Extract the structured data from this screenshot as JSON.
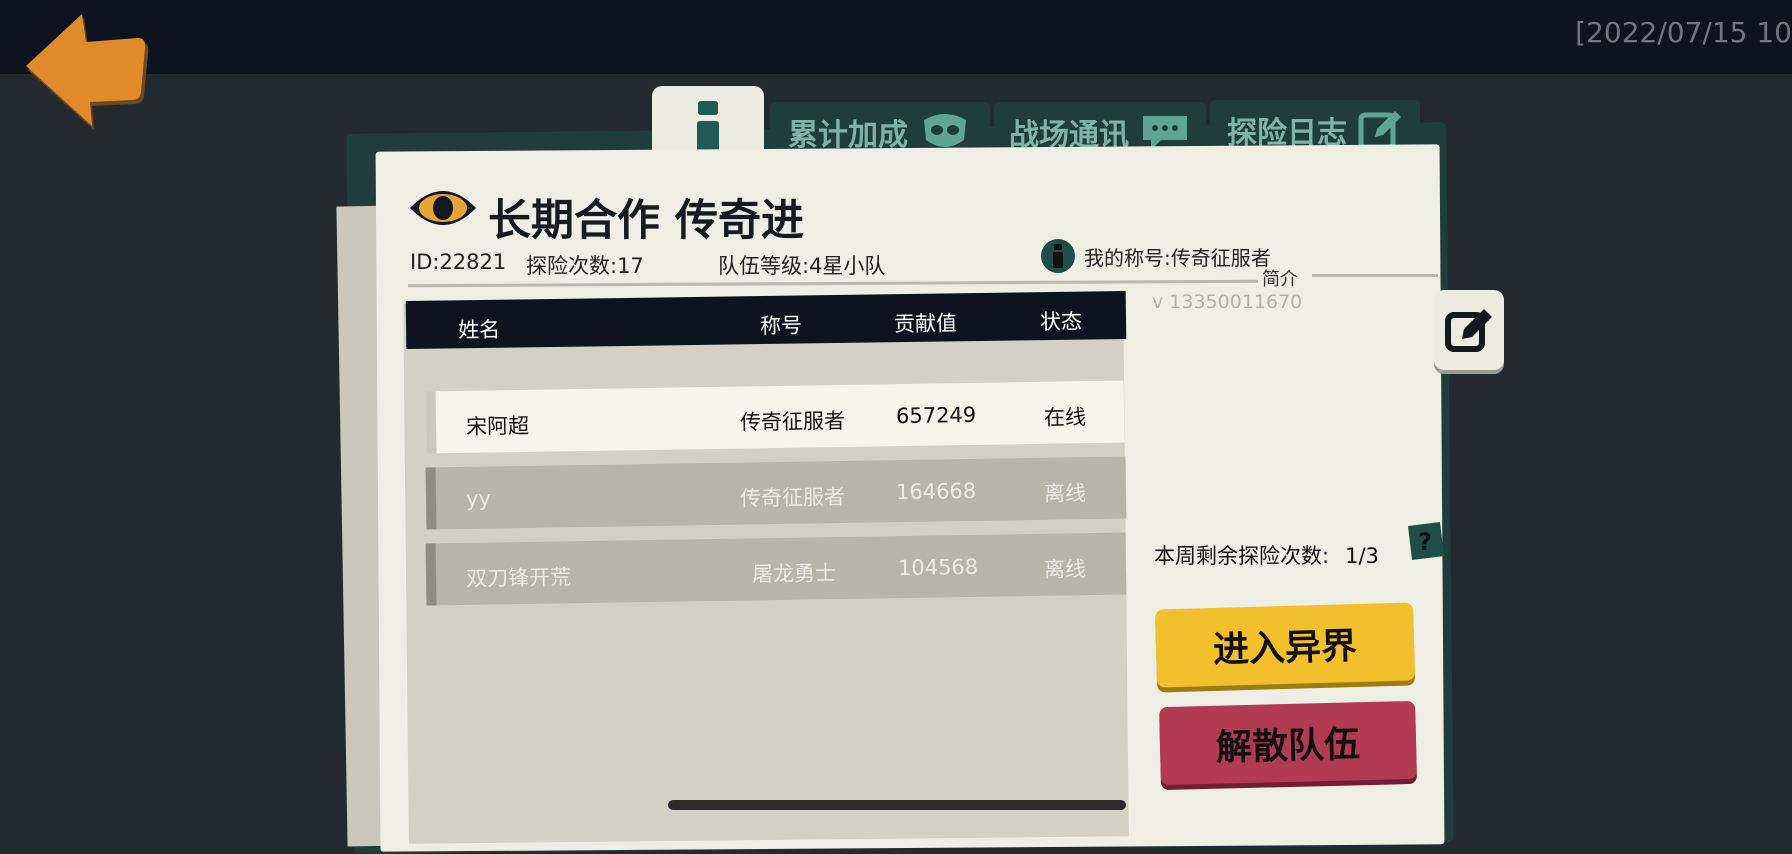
{
  "top": {
    "timestamp": "[2022/07/15 10"
  },
  "tabs": [
    {
      "label": "累计加成",
      "icon": "mask-icon"
    },
    {
      "label": "战场通讯",
      "icon": "chat-bubble-icon"
    },
    {
      "label": "探险日志",
      "icon": "edit-pencil-icon"
    }
  ],
  "team": {
    "name": "长期合作 传奇进",
    "id": "ID:22821",
    "expeditions": "探险次数:17",
    "level": "队伍等级:4星小队",
    "my_title": "我的称号:传奇征服者",
    "intro_label": "简介",
    "intro_text": "v 13350011670"
  },
  "table": {
    "headers": {
      "name": "姓名",
      "title": "称号",
      "contribution": "贡献值",
      "status": "状态"
    },
    "rows": [
      {
        "name": "宋阿超",
        "title": "传奇征服者",
        "contribution": "657249",
        "status": "在线"
      },
      {
        "name": "yy",
        "title": "传奇征服者",
        "contribution": "164668",
        "status": "离线"
      },
      {
        "name": "双刀锋开荒",
        "title": "屠龙勇士",
        "contribution": "104568",
        "status": "离线"
      }
    ]
  },
  "weekly": {
    "label": "本周剩余探险次数:",
    "value": "1/3"
  },
  "buttons": {
    "enter": "进入异界",
    "disband": "解散队伍"
  },
  "colors": {
    "accent_teal": "#1f3e3a",
    "enter_yellow": "#f2c02c",
    "disband_red": "#b23a52",
    "back_orange": "#e08a2c"
  }
}
